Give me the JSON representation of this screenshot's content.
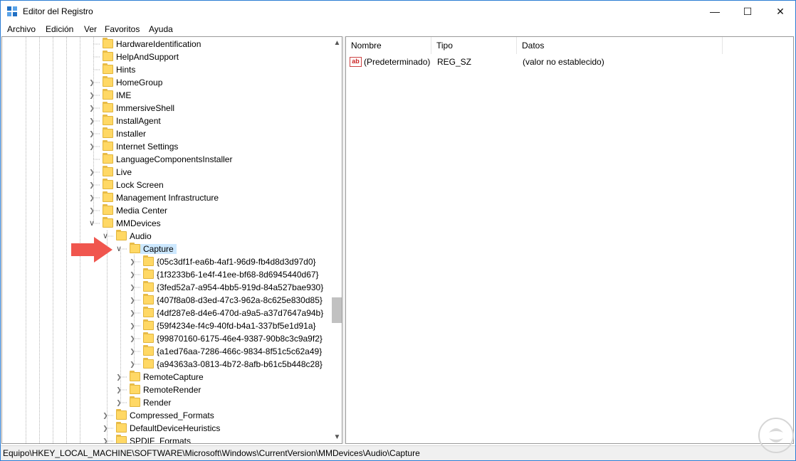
{
  "window": {
    "title": "Editor del Registro",
    "min_glyph": "—",
    "max_glyph": "☐",
    "close_glyph": "✕"
  },
  "menu": [
    "Archivo",
    "Edición",
    "Ver",
    "Favoritos",
    "Ayuda"
  ],
  "tree": {
    "items": [
      {
        "label": "HardwareIdentification",
        "expander": ""
      },
      {
        "label": "HelpAndSupport",
        "expander": ""
      },
      {
        "label": "Hints",
        "expander": ""
      },
      {
        "label": "HomeGroup",
        "expander": ">"
      },
      {
        "label": "IME",
        "expander": ">"
      },
      {
        "label": "ImmersiveShell",
        "expander": ">"
      },
      {
        "label": "InstallAgent",
        "expander": ">"
      },
      {
        "label": "Installer",
        "expander": ">"
      },
      {
        "label": "Internet Settings",
        "expander": ">"
      },
      {
        "label": "LanguageComponentsInstaller",
        "expander": ""
      },
      {
        "label": "Live",
        "expander": ">"
      },
      {
        "label": "Lock Screen",
        "expander": ">"
      },
      {
        "label": "Management Infrastructure",
        "expander": ">"
      },
      {
        "label": "Media Center",
        "expander": ">"
      },
      {
        "label": "MMDevices",
        "expander": "v"
      },
      {
        "label": "Audio",
        "expander": "v"
      },
      {
        "label": "Capture",
        "expander": "v"
      },
      {
        "label": "{05c3df1f-ea6b-4af1-96d9-fb4d8d3d97d0}",
        "expander": ">"
      },
      {
        "label": "{1f3233b6-1e4f-41ee-bf68-8d6945440d67}",
        "expander": ">"
      },
      {
        "label": "{3fed52a7-a954-4bb5-919d-84a527bae930}",
        "expander": ">"
      },
      {
        "label": "{407f8a08-d3ed-47c3-962a-8c625e830d85}",
        "expander": ">"
      },
      {
        "label": "{4df287e8-d4e6-470d-a9a5-a37d7647a94b}",
        "expander": ">"
      },
      {
        "label": "{59f4234e-f4c9-40fd-b4a1-337bf5e1d91a}",
        "expander": ">"
      },
      {
        "label": "{99870160-6175-46e4-9387-90b8c3c9a9f2}",
        "expander": ">"
      },
      {
        "label": "{a1ed76aa-7286-466c-9834-8f51c5c62a49}",
        "expander": ">"
      },
      {
        "label": "{a94363a3-0813-4b72-8afb-b61c5b448c28}",
        "expander": ">"
      },
      {
        "label": "RemoteCapture",
        "expander": ">"
      },
      {
        "label": "RemoteRender",
        "expander": ">"
      },
      {
        "label": "Render",
        "expander": ">"
      },
      {
        "label": "Compressed_Formats",
        "expander": ">"
      },
      {
        "label": "DefaultDeviceHeuristics",
        "expander": ">"
      },
      {
        "label": "SPDIF_Formats",
        "expander": ">"
      }
    ],
    "selected": "Capture"
  },
  "list": {
    "columns": [
      "Nombre",
      "Tipo",
      "Datos"
    ],
    "rows": [
      {
        "name": "(Predeterminado)",
        "type": "REG_SZ",
        "data": "(valor no establecido)",
        "icon": "ab"
      }
    ]
  },
  "status": "Equipo\\HKEY_LOCAL_MACHINE\\SOFTWARE\\Microsoft\\Windows\\CurrentVersion\\MMDevices\\Audio\\Capture",
  "colors": {
    "accent": "#2b7cd3",
    "selection": "#cce8ff",
    "folder": "#ffd865",
    "arrow": "#f0564e"
  }
}
